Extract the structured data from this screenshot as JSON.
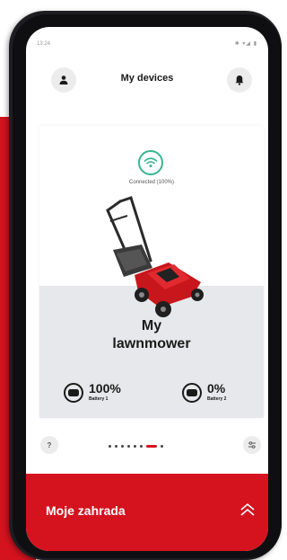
{
  "status_bar": {
    "time": "13:24",
    "icons": "✱ ▾◢ ▮"
  },
  "header": {
    "title": "My devices",
    "profile_icon": "person-icon",
    "notifications_icon": "bell-icon"
  },
  "device": {
    "connection_status": "Connected (100%)",
    "connection_icon": "wifi-icon",
    "name_line1": "My",
    "name_line2": "lawnmower",
    "batteries": [
      {
        "percent": "100%",
        "label": "Battery 1"
      },
      {
        "percent": "0%",
        "label": "Battery 2"
      }
    ]
  },
  "pager": {
    "help_label": "?",
    "page_count": 8,
    "active_index": 6
  },
  "bottom_bar": {
    "title": "Moje zahrada",
    "expand_icon": "double-chevron-up-icon"
  },
  "colors": {
    "accent": "#d4131f",
    "connected": "#37b68d",
    "card_lower": "#e6e8eb"
  }
}
